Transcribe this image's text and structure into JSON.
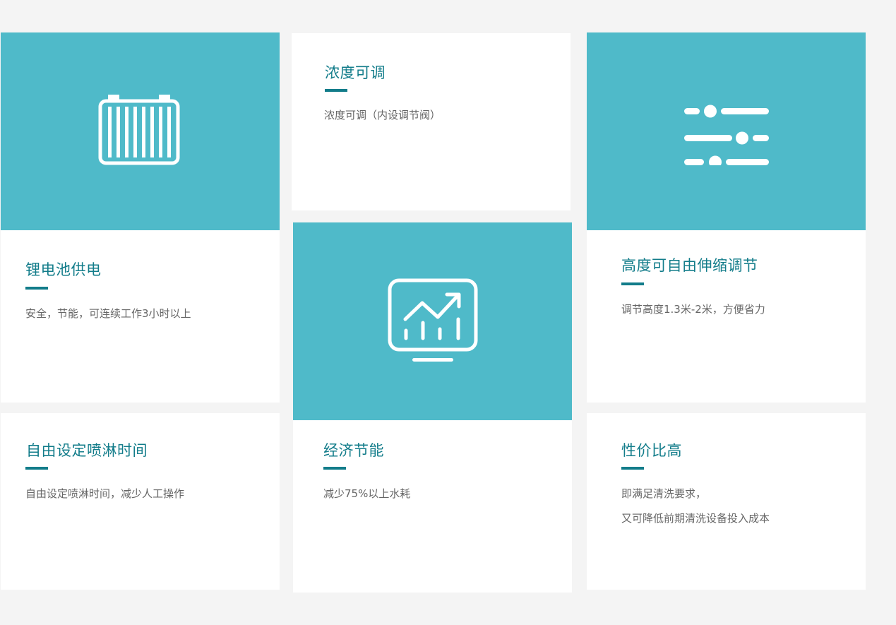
{
  "colors": {
    "page_background": "#f4f4f4",
    "card_teal": "#4fbac9",
    "card_white": "#ffffff",
    "title_accent": "#127c8a",
    "description_text": "#666666"
  },
  "features": {
    "battery": {
      "icon": "battery-icon",
      "title": "锂电池供电",
      "description": "安全，节能，可连续工作3小时以上"
    },
    "concentration": {
      "title": "浓度可调",
      "description": "浓度可调（内设调节阀）"
    },
    "adjust": {
      "icon": "sliders-icon",
      "title": "高度可自由伸缩调节",
      "description": "调节高度1.3米-2米，方便省力"
    },
    "economy": {
      "icon": "chart-monitor-icon",
      "title": "经济节能",
      "description": "减少75%以上水耗"
    },
    "timer": {
      "title": "自由设定喷淋时间",
      "description": "自由设定喷淋时间，减少人工操作"
    },
    "value": {
      "title": "性价比高",
      "description_lines": [
        "即满足清洗要求，",
        "又可降低前期清洗设备投入成本"
      ]
    }
  }
}
